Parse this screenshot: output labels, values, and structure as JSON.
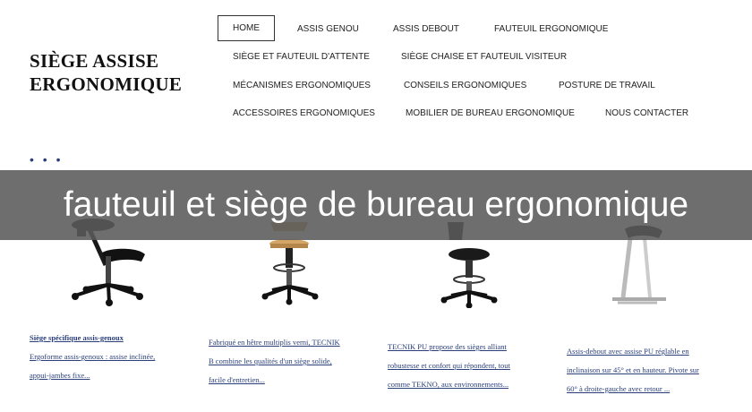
{
  "site": {
    "logo_line1": "SIÈGE ASSISE",
    "logo_line2": "ERGONOMIQUE"
  },
  "nav": {
    "items": [
      {
        "label": "HOME"
      },
      {
        "label": "ASSIS GENOU"
      },
      {
        "label": "ASSIS DEBOUT"
      },
      {
        "label": "FAUTEUIL ERGONOMIQUE"
      },
      {
        "label": "SIÈGE ET FAUTEUIL D'ATTENTE"
      },
      {
        "label": "SIÈGE CHAISE ET FAUTEUIL VISITEUR"
      },
      {
        "label": "MÉCANISMES ERGONOMIQUES"
      },
      {
        "label": "CONSEILS ERGONOMIQUES"
      },
      {
        "label": "POSTURE DE TRAVAIL"
      },
      {
        "label": "ACCESSOIRES ERGONOMIQUES"
      },
      {
        "label": "MOBILIER DE BUREAU ERGONOMIQUE"
      },
      {
        "label": "NOUS CONTACTER"
      }
    ]
  },
  "breadcrumb_dots": "• • •",
  "banner": {
    "title": "fauteuil et siège de bureau ergonomique"
  },
  "products": [
    {
      "icon": "kneeling-chair-icon",
      "lines": [
        "Siège spécifique assis-genoux",
        "Ergoforme assis-genoux : assise inclinée,",
        "appui-jambes fixe..."
      ]
    },
    {
      "icon": "wooden-stool-icon",
      "lines": [
        "Fabriqué en hêtre multiplis verni, TECNIK",
        "B combine les qualités d'un siège solide,",
        "facile d'entretien..."
      ]
    },
    {
      "icon": "tecnik-stool-icon",
      "lines": [
        "TECNIK PU propose des sièges alliant",
        "robustesse et confort qui répondent, tout",
        "comme TEKNO, aux environnements..."
      ]
    },
    {
      "icon": "sit-stand-stool-icon",
      "lines": [
        "Assis-debout avec assise PU réglable en",
        "inclinaison sur 45° et en hauteur. Pivote sur",
        "60° à droite-gauche avec retour ..."
      ]
    }
  ]
}
